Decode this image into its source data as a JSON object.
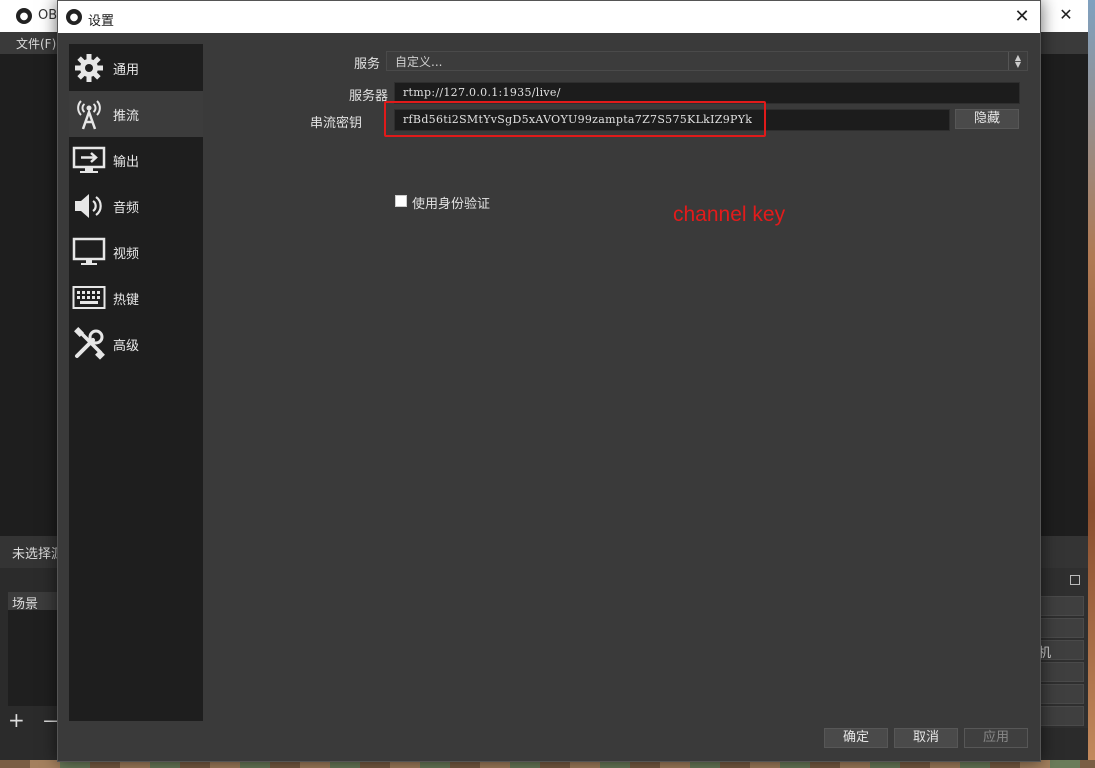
{
  "background_window": {
    "title": "OB",
    "menu_file": "文件(F)",
    "no_source_text": "未选择源",
    "scenes_label": "场景",
    "scene_tools": "+ —",
    "right_partial_text": "机"
  },
  "dialog": {
    "title": "设置",
    "close_icon": "close-icon",
    "sidebar": {
      "items": [
        {
          "label": "通用",
          "icon": "gear-icon"
        },
        {
          "label": "推流",
          "icon": "broadcast-icon"
        },
        {
          "label": "输出",
          "icon": "output-icon"
        },
        {
          "label": "音频",
          "icon": "speaker-icon"
        },
        {
          "label": "视频",
          "icon": "monitor-icon"
        },
        {
          "label": "热键",
          "icon": "keyboard-icon"
        },
        {
          "label": "高级",
          "icon": "tools-icon"
        }
      ],
      "active_index": 1
    },
    "stream": {
      "service_label": "服务",
      "service_value": "自定义...",
      "server_label": "服务器",
      "server_value": "rtmp://127.0.0.1:1935/live/",
      "key_label": "串流密钥",
      "key_value": "rfBd56ti2SMtYvSgD5xAVOYU99zampta7Z7S575KLkIZ9PYk",
      "hide_button": "隐藏",
      "auth_checkbox_label": "使用身份验证",
      "auth_checked": false
    },
    "annotation": {
      "text": "channel key",
      "color": "#e31b1b"
    },
    "footer": {
      "ok": "确定",
      "cancel": "取消",
      "apply": "应用"
    }
  }
}
